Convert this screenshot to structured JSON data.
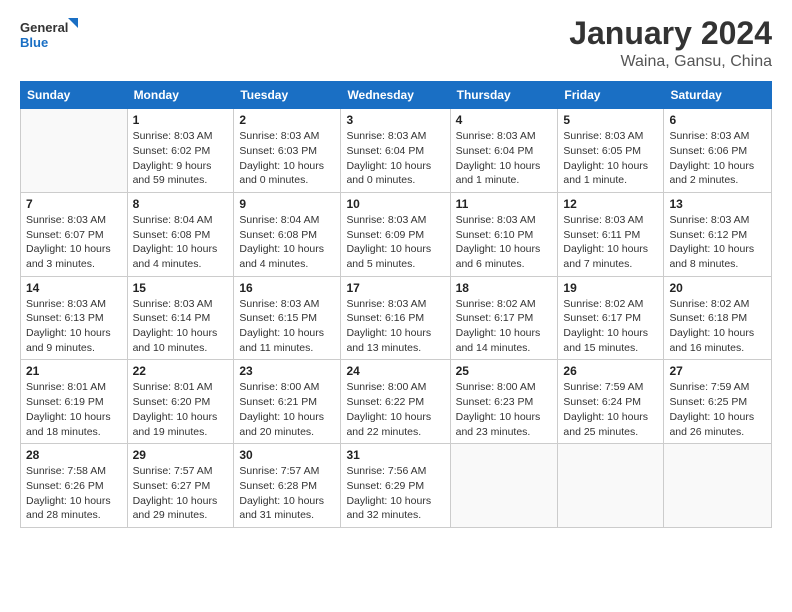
{
  "header": {
    "logo_general": "General",
    "logo_blue": "Blue",
    "main_title": "January 2024",
    "sub_title": "Waina, Gansu, China"
  },
  "weekdays": [
    "Sunday",
    "Monday",
    "Tuesday",
    "Wednesday",
    "Thursday",
    "Friday",
    "Saturday"
  ],
  "weeks": [
    [
      {
        "day": "",
        "info": ""
      },
      {
        "day": "1",
        "info": "Sunrise: 8:03 AM\nSunset: 6:02 PM\nDaylight: 9 hours\nand 59 minutes."
      },
      {
        "day": "2",
        "info": "Sunrise: 8:03 AM\nSunset: 6:03 PM\nDaylight: 10 hours\nand 0 minutes."
      },
      {
        "day": "3",
        "info": "Sunrise: 8:03 AM\nSunset: 6:04 PM\nDaylight: 10 hours\nand 0 minutes."
      },
      {
        "day": "4",
        "info": "Sunrise: 8:03 AM\nSunset: 6:04 PM\nDaylight: 10 hours\nand 1 minute."
      },
      {
        "day": "5",
        "info": "Sunrise: 8:03 AM\nSunset: 6:05 PM\nDaylight: 10 hours\nand 1 minute."
      },
      {
        "day": "6",
        "info": "Sunrise: 8:03 AM\nSunset: 6:06 PM\nDaylight: 10 hours\nand 2 minutes."
      }
    ],
    [
      {
        "day": "7",
        "info": "Sunrise: 8:03 AM\nSunset: 6:07 PM\nDaylight: 10 hours\nand 3 minutes."
      },
      {
        "day": "8",
        "info": "Sunrise: 8:04 AM\nSunset: 6:08 PM\nDaylight: 10 hours\nand 4 minutes."
      },
      {
        "day": "9",
        "info": "Sunrise: 8:04 AM\nSunset: 6:08 PM\nDaylight: 10 hours\nand 4 minutes."
      },
      {
        "day": "10",
        "info": "Sunrise: 8:03 AM\nSunset: 6:09 PM\nDaylight: 10 hours\nand 5 minutes."
      },
      {
        "day": "11",
        "info": "Sunrise: 8:03 AM\nSunset: 6:10 PM\nDaylight: 10 hours\nand 6 minutes."
      },
      {
        "day": "12",
        "info": "Sunrise: 8:03 AM\nSunset: 6:11 PM\nDaylight: 10 hours\nand 7 minutes."
      },
      {
        "day": "13",
        "info": "Sunrise: 8:03 AM\nSunset: 6:12 PM\nDaylight: 10 hours\nand 8 minutes."
      }
    ],
    [
      {
        "day": "14",
        "info": "Sunrise: 8:03 AM\nSunset: 6:13 PM\nDaylight: 10 hours\nand 9 minutes."
      },
      {
        "day": "15",
        "info": "Sunrise: 8:03 AM\nSunset: 6:14 PM\nDaylight: 10 hours\nand 10 minutes."
      },
      {
        "day": "16",
        "info": "Sunrise: 8:03 AM\nSunset: 6:15 PM\nDaylight: 10 hours\nand 11 minutes."
      },
      {
        "day": "17",
        "info": "Sunrise: 8:03 AM\nSunset: 6:16 PM\nDaylight: 10 hours\nand 13 minutes."
      },
      {
        "day": "18",
        "info": "Sunrise: 8:02 AM\nSunset: 6:17 PM\nDaylight: 10 hours\nand 14 minutes."
      },
      {
        "day": "19",
        "info": "Sunrise: 8:02 AM\nSunset: 6:17 PM\nDaylight: 10 hours\nand 15 minutes."
      },
      {
        "day": "20",
        "info": "Sunrise: 8:02 AM\nSunset: 6:18 PM\nDaylight: 10 hours\nand 16 minutes."
      }
    ],
    [
      {
        "day": "21",
        "info": "Sunrise: 8:01 AM\nSunset: 6:19 PM\nDaylight: 10 hours\nand 18 minutes."
      },
      {
        "day": "22",
        "info": "Sunrise: 8:01 AM\nSunset: 6:20 PM\nDaylight: 10 hours\nand 19 minutes."
      },
      {
        "day": "23",
        "info": "Sunrise: 8:00 AM\nSunset: 6:21 PM\nDaylight: 10 hours\nand 20 minutes."
      },
      {
        "day": "24",
        "info": "Sunrise: 8:00 AM\nSunset: 6:22 PM\nDaylight: 10 hours\nand 22 minutes."
      },
      {
        "day": "25",
        "info": "Sunrise: 8:00 AM\nSunset: 6:23 PM\nDaylight: 10 hours\nand 23 minutes."
      },
      {
        "day": "26",
        "info": "Sunrise: 7:59 AM\nSunset: 6:24 PM\nDaylight: 10 hours\nand 25 minutes."
      },
      {
        "day": "27",
        "info": "Sunrise: 7:59 AM\nSunset: 6:25 PM\nDaylight: 10 hours\nand 26 minutes."
      }
    ],
    [
      {
        "day": "28",
        "info": "Sunrise: 7:58 AM\nSunset: 6:26 PM\nDaylight: 10 hours\nand 28 minutes."
      },
      {
        "day": "29",
        "info": "Sunrise: 7:57 AM\nSunset: 6:27 PM\nDaylight: 10 hours\nand 29 minutes."
      },
      {
        "day": "30",
        "info": "Sunrise: 7:57 AM\nSunset: 6:28 PM\nDaylight: 10 hours\nand 31 minutes."
      },
      {
        "day": "31",
        "info": "Sunrise: 7:56 AM\nSunset: 6:29 PM\nDaylight: 10 hours\nand 32 minutes."
      },
      {
        "day": "",
        "info": ""
      },
      {
        "day": "",
        "info": ""
      },
      {
        "day": "",
        "info": ""
      }
    ]
  ]
}
